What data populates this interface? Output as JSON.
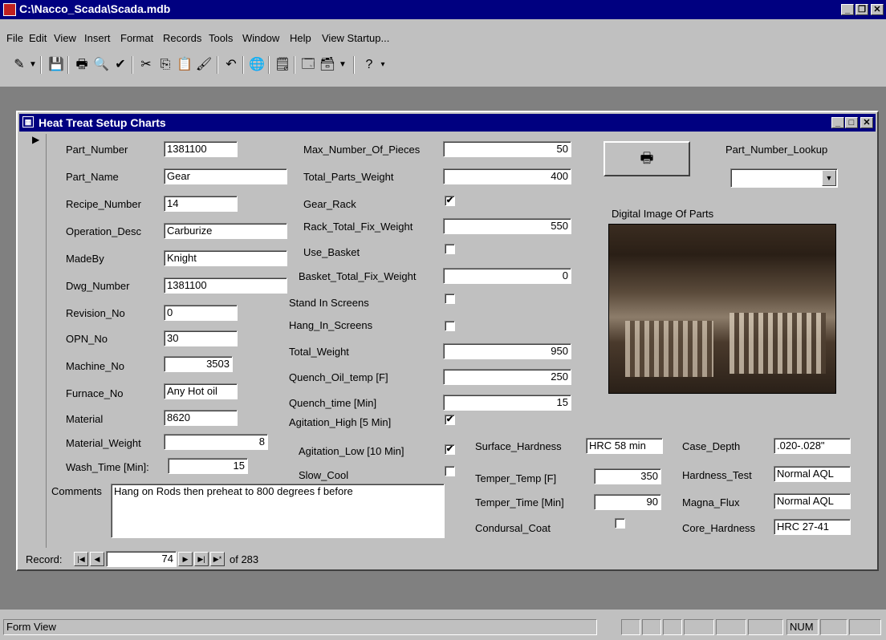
{
  "window": {
    "title": "C:\\Nacco_Scada\\Scada.mdb"
  },
  "menu": [
    "File",
    "Edit",
    "View",
    "Insert",
    "Format",
    "Records",
    "Tools",
    "Window",
    "Help",
    "View Startup..."
  ],
  "form": {
    "title": "Heat Treat Setup Charts",
    "fields": {
      "part_number": {
        "label": "Part_Number",
        "value": "1381100"
      },
      "part_name": {
        "label": "Part_Name",
        "value": "Gear"
      },
      "recipe_number": {
        "label": "Recipe_Number",
        "value": "14"
      },
      "operation_desc": {
        "label": "Operation_Desc",
        "value": "Carburize"
      },
      "madeby": {
        "label": "MadeBy",
        "value": "Knight"
      },
      "dwg_number": {
        "label": "Dwg_Number",
        "value": "1381100"
      },
      "revision_no": {
        "label": "Revision_No",
        "value": "0"
      },
      "opn_no": {
        "label": "OPN_No",
        "value": "30"
      },
      "machine_no": {
        "label": "Machine_No",
        "value": "3503"
      },
      "furnace_no": {
        "label": "Furnace_No",
        "value": "Any Hot oil"
      },
      "material": {
        "label": "Material",
        "value": "8620"
      },
      "material_weight": {
        "label": "Material_Weight",
        "value": "8"
      },
      "wash_time": {
        "label": "Wash_Time [Min]:",
        "value": "15"
      },
      "comments": {
        "label": "Comments",
        "value": "Hang on Rods then preheat to 800 degrees f before"
      },
      "max_pieces": {
        "label": "Max_Number_Of_Pieces",
        "value": "50"
      },
      "total_parts_weight": {
        "label": "Total_Parts_Weight",
        "value": "400"
      },
      "gear_rack": {
        "label": "Gear_Rack",
        "checked": true
      },
      "rack_total_fix_weight": {
        "label": "Rack_Total_Fix_Weight",
        "value": "550"
      },
      "use_basket": {
        "label": "Use_Basket",
        "checked": false
      },
      "basket_total_fix_weight": {
        "label": "Basket_Total_Fix_Weight",
        "value": "0"
      },
      "stand_in_screens": {
        "label": "Stand In Screens",
        "checked": false
      },
      "hang_in_screens": {
        "label": "Hang_In_Screens",
        "checked": false
      },
      "total_weight": {
        "label": "Total_Weight",
        "value": "950"
      },
      "quench_oil_temp": {
        "label": "Quench_Oil_temp [F]",
        "value": "250"
      },
      "quench_time": {
        "label": "Quench_time [Min]",
        "value": "15"
      },
      "agitation_high": {
        "label": "Agitation_High [5 Min]",
        "checked": true
      },
      "agitation_low": {
        "label": "Agitation_Low [10 Min]",
        "checked": true
      },
      "slow_cool": {
        "label": "Slow_Cool",
        "checked": false
      },
      "surface_hardness": {
        "label": "Surface_Hardness",
        "value": "HRC 58 min"
      },
      "temper_temp": {
        "label": "Temper_Temp [F]",
        "value": "350"
      },
      "temper_time": {
        "label": "Temper_Time  [Min]",
        "value": "90"
      },
      "condursal_coat": {
        "label": "Condursal_Coat",
        "checked": false
      },
      "case_depth": {
        "label": "Case_Depth",
        "value": ".020-.028\""
      },
      "hardness_test": {
        "label": "Hardness_Test",
        "value": "Normal AQL"
      },
      "magna_flux": {
        "label": "Magna_Flux",
        "value": "Normal AQL"
      },
      "core_hardness": {
        "label": "Core_Hardness",
        "value": "HRC 27-41"
      },
      "part_number_lookup": {
        "label": "Part_Number_Lookup",
        "value": ""
      },
      "digital_image": {
        "label": "Digital Image Of Parts"
      }
    },
    "nav": {
      "label": "Record:",
      "current": "74",
      "of_label": "of 283"
    }
  },
  "status": {
    "view": "Form View",
    "num": "NUM"
  }
}
